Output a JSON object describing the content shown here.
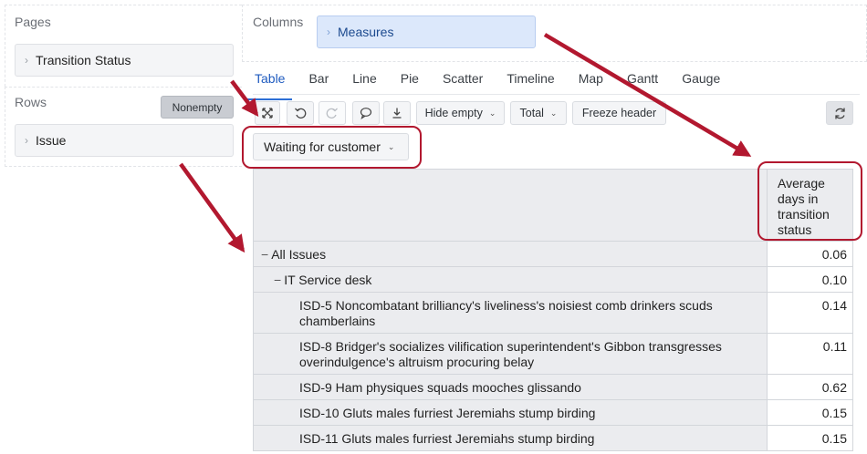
{
  "pages_panel": {
    "title": "Pages",
    "dimension": "Transition Status"
  },
  "rows_panel": {
    "title": "Rows",
    "nonempty_label": "Nonempty",
    "dimension": "Issue"
  },
  "columns_panel": {
    "title": "Columns",
    "dimension": "Measures"
  },
  "tabs": [
    "Table",
    "Bar",
    "Line",
    "Pie",
    "Scatter",
    "Timeline",
    "Map",
    "Gantt",
    "Gauge"
  ],
  "active_tab": "Table",
  "toolbar": {
    "hide_empty_label": "Hide empty",
    "total_label": "Total",
    "freeze_header_label": "Freeze header",
    "icons": [
      "expand-icon",
      "undo-icon",
      "redo-icon",
      "comment-icon",
      "export-icon",
      "refresh-icon"
    ]
  },
  "page_filter": {
    "value": "Waiting for customer"
  },
  "table": {
    "measure_header": "Average days in transition status",
    "rows": [
      {
        "label": "All Issues",
        "value": "0.06",
        "level": 0,
        "collapse": "−"
      },
      {
        "label": "IT Service desk",
        "value": "0.10",
        "level": 1,
        "collapse": "−"
      },
      {
        "label": "ISD-5 Noncombatant brilliancy's liveliness's noisiest comb drinkers scuds chamberlains",
        "value": "0.14",
        "level": 2
      },
      {
        "label": "ISD-8 Bridger's socializes vilification superintendent's Gibbon transgresses overindulgence's altruism procuring belay",
        "value": "0.11",
        "level": 2
      },
      {
        "label": "ISD-9 Ham physiques squads mooches glissando",
        "value": "0.62",
        "level": 2
      },
      {
        "label": "ISD-10 Gluts males furriest Jeremiahs stump birding",
        "value": "0.15",
        "level": 2
      },
      {
        "label": "ISD-11 Gluts males furriest Jeremiahs stump birding",
        "value": "0.15",
        "level": 2
      }
    ]
  },
  "colors": {
    "highlight": "#b2182f",
    "accent": "#1f5bbf",
    "measure_chip": "#dce8fb"
  }
}
